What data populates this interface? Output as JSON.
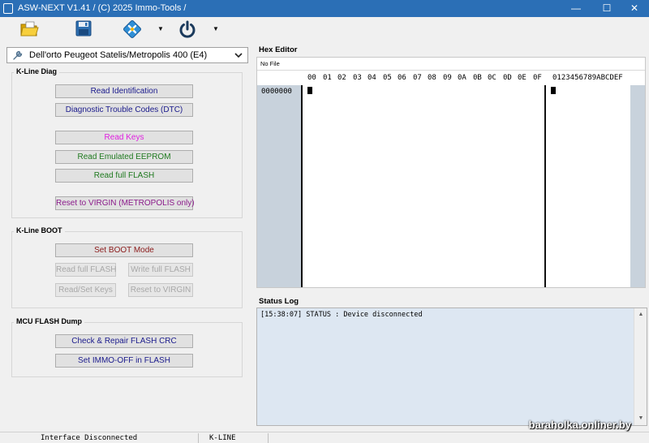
{
  "window": {
    "title": "ASW-NEXT V1.41 / (C) 2025 Immo-Tools /",
    "min_label": "—",
    "max_label": "☐",
    "close_label": "✕"
  },
  "toolbar": {
    "open_icon": "folder-open-icon",
    "save_icon": "floppy-disk-icon",
    "tools_icon": "tools-icon",
    "power_icon": "power-icon",
    "caret": "▼"
  },
  "model": {
    "selected": "Dell'orto Peugeot Satelis/Metropolis 400 (E4)",
    "icon": "wrench-icon"
  },
  "kline_diag": {
    "title": "K-Line Diag",
    "read_identification": "Read Identification",
    "read_dtc": "Diagnostic Trouble Codes (DTC)",
    "read_keys": "Read Keys",
    "read_emulated_eeprom": "Read Emulated EEPROM",
    "read_full_flash": "Read full FLASH",
    "reset_virgin": "Reset to VIRGIN (METROPOLIS only)"
  },
  "kline_boot": {
    "title": "K-Line BOOT",
    "set_boot_mode": "Set BOOT Mode",
    "read_full_flash": "Read full FLASH",
    "write_full_flash": "Write full FLASH",
    "read_set_keys": "Read/Set Keys",
    "reset_virgin": "Reset to VIRGIN"
  },
  "mcu_dump": {
    "title": "MCU FLASH Dump",
    "check_repair_crc": "Check & Repair FLASH CRC",
    "set_immo_off": "Set IMMO-OFF in FLASH"
  },
  "hex_editor": {
    "title": "Hex Editor",
    "file": "No File",
    "columns": [
      "00",
      "01",
      "02",
      "03",
      "04",
      "05",
      "06",
      "07",
      "08",
      "09",
      "0A",
      "0B",
      "0C",
      "0D",
      "0E",
      "0F"
    ],
    "ascii_header": "0123456789ABCDEF",
    "offset": "0000000"
  },
  "status_log": {
    "title": "Status Log",
    "entries": [
      "[15:38:07] STATUS : Device disconnected"
    ]
  },
  "statusbar": {
    "interface": "Interface Disconnected",
    "protocol": "K-LINE"
  },
  "watermark": "baraholka.onliner.by",
  "colors": {
    "titlebar": "#2b6fb6",
    "btn_blue": "#1a1a8c",
    "btn_magenta": "#e020e0",
    "btn_green": "#1f7a1f",
    "btn_purple": "#8b1a8b",
    "btn_darkred": "#8b1a1a",
    "hex_gutter": "#c8d2dc",
    "status_bg": "#dde7f2"
  }
}
